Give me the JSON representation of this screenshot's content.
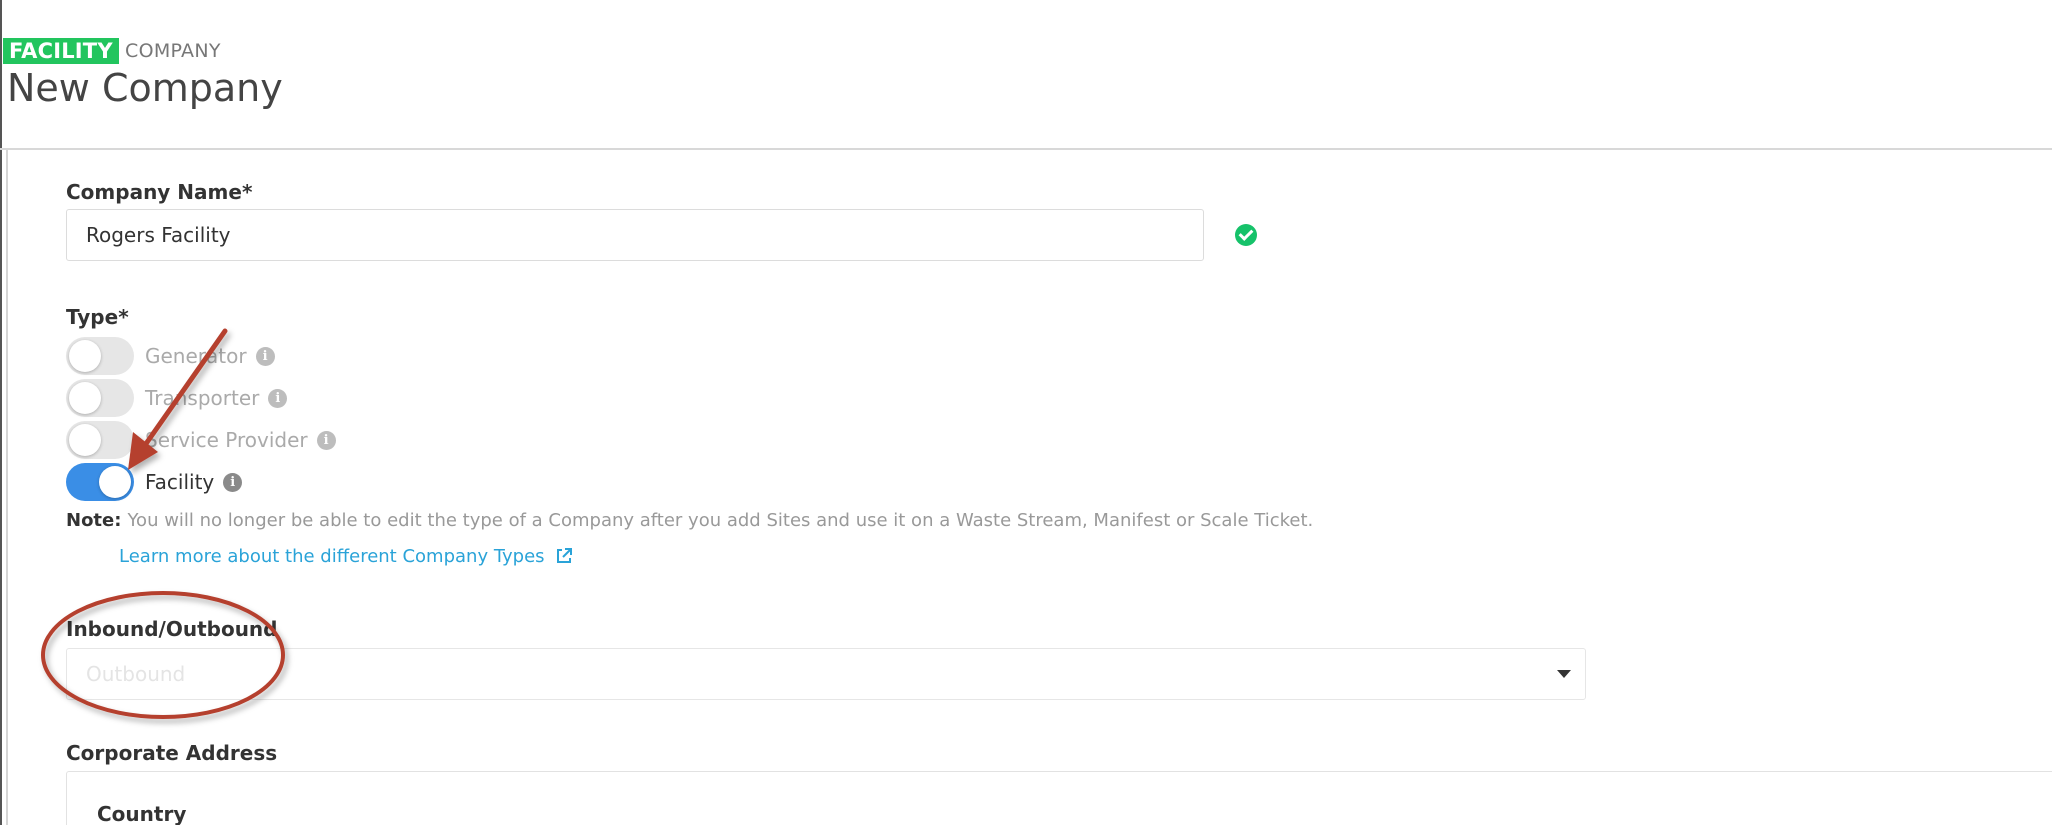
{
  "header": {
    "badge": "FACILITY",
    "breadcrumb": "COMPANY",
    "title": "New Company"
  },
  "form": {
    "company_name": {
      "label": "Company Name*",
      "value": "Rogers Facility",
      "status_icon": "check-circle-icon"
    },
    "type": {
      "label": "Type*",
      "options": [
        {
          "label": "Generator",
          "on": false
        },
        {
          "label": "Transporter",
          "on": false
        },
        {
          "label": "Service Provider",
          "on": false
        },
        {
          "label": "Facility",
          "on": true
        }
      ],
      "note_label": "Note:",
      "note_text": "You will no longer be able to edit the type of a Company after you add Sites and use it on a Waste Stream, Manifest or Scale Ticket.",
      "learn_more": "Learn more about the different Company Types"
    },
    "inbound_outbound": {
      "label": "Inbound/Outbound",
      "value": "Outbound"
    },
    "corporate_address": {
      "label": "Corporate Address",
      "country_label": "Country"
    }
  },
  "colors": {
    "badge": "#22c55e",
    "toggle_on": "#3a8ee6",
    "link": "#2aa3d8",
    "annotation": "#b5412f"
  }
}
